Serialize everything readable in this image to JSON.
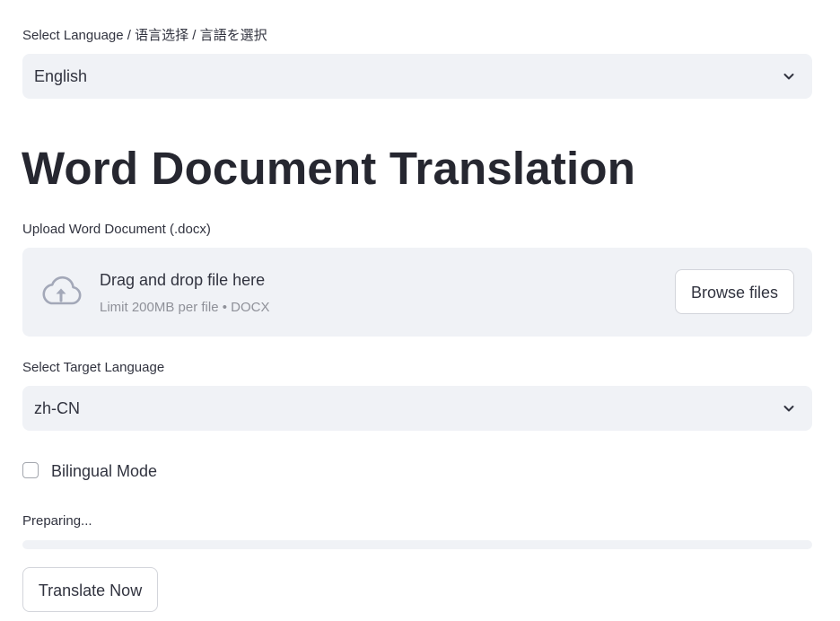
{
  "ui_language": {
    "label": "Select Language / 语言选择 / 言語を選択",
    "selected": "English",
    "chevron_icon": "chevron-down-icon"
  },
  "page_title": "Word Document Translation",
  "upload": {
    "label": "Upload Word Document (.docx)",
    "drop_text": "Drag and drop file here",
    "limit_text": "Limit 200MB per file • DOCX",
    "browse_label": "Browse files",
    "icon": "cloud-upload-icon"
  },
  "target_language": {
    "label": "Select Target Language",
    "selected": "zh-CN",
    "chevron_icon": "chevron-down-icon"
  },
  "bilingual": {
    "label": "Bilingual Mode",
    "checked": false
  },
  "progress": {
    "status_text": "Preparing...",
    "fraction": 0.0
  },
  "actions": {
    "translate_label": "Translate Now"
  },
  "colors": {
    "background": "#ffffff",
    "surface": "#f0f2f6",
    "text": "#31333f",
    "muted_text": "#8f9199",
    "icon": "#a3a8b8",
    "accent": "#ff4b4b"
  }
}
